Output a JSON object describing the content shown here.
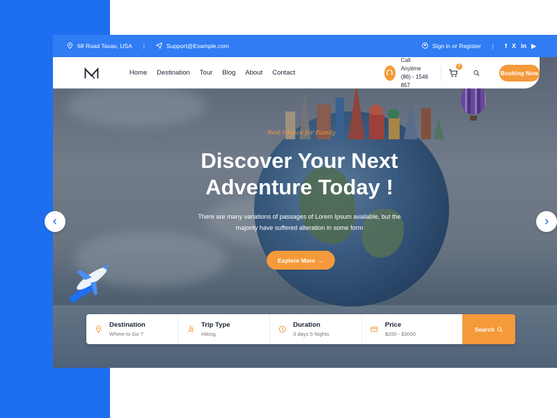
{
  "topbar": {
    "address": "68 Road Taxax, USA",
    "separator": "|",
    "email": "Support@Example.com",
    "signin": "Sign in or Register",
    "separator2": "|",
    "social": [
      "f",
      "X",
      "in",
      "▶"
    ]
  },
  "nav": {
    "items": [
      "Home",
      "Destination",
      "Tour",
      "Blog",
      "About",
      "Contact"
    ],
    "call_label": "Call Anytime",
    "call_number": "(86) - 1546 857",
    "cart_count": "3",
    "booking_label": "Booking Now"
  },
  "hero": {
    "tagline": "Best Choice for Family",
    "headline_line1": "Discover Your Next",
    "headline_line2": "Adventure Today !",
    "subtext_line1": "There are many variations of passages of Lorem Ipsum available, but the",
    "subtext_line2": "majority have suffered alteration in some form",
    "explore_label": "Explore More",
    "explore_arrow": "→"
  },
  "search": {
    "fields": [
      {
        "label": "Destination",
        "value": "Where to Go ?",
        "icon": "location-pin-icon"
      },
      {
        "label": "Trip Type",
        "value": "Hiking",
        "icon": "hiker-icon"
      },
      {
        "label": "Duration",
        "value": "3 days 5 Nights",
        "icon": "clock-icon"
      },
      {
        "label": "Price",
        "value": "$200 - $3000",
        "icon": "ticket-icon"
      }
    ],
    "button_label": "Search"
  },
  "colors": {
    "brand_blue": "#1e6ff0",
    "accent_orange": "#f59a3b"
  }
}
